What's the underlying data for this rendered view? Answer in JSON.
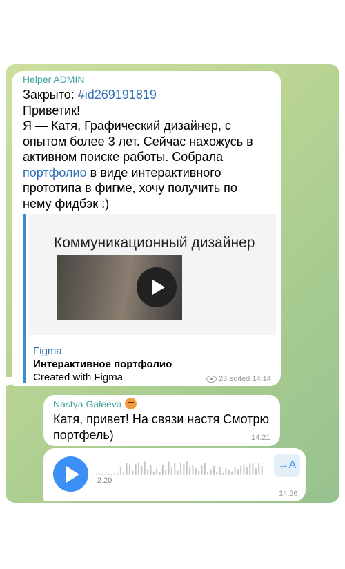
{
  "message1": {
    "sender": "Helper ADMIN",
    "closed_label": "Закрыто: ",
    "ticket_tag": "#id269191819",
    "greeting": "Приветик!",
    "line1": "Я — Катя, Графический дизайнер, с",
    "line2": "опытом более 3 лет. Сейчас нахожусь в",
    "line3": "активном поиске работы. Собрала",
    "portfolio_link": "портфолио",
    "line4_rest": " в виде интерактивного",
    "line5": "прототипа в фигме, хочу получить по",
    "line6": "нему фидбэк :)",
    "preview": {
      "image_title": "Коммуникационный дизайнер",
      "site": "Figma",
      "name": "Интерактивное портфолио",
      "description": "Created with Figma"
    },
    "views": "23",
    "edited_time": "edited 14:14"
  },
  "message2": {
    "sender": "Nastya Galeeva",
    "line1": "Катя, привет! На связи настя Смотрю",
    "line2": "портфель)",
    "time": "14:21"
  },
  "message3": {
    "duration": "2:20",
    "transcribe_label": "→A",
    "time": "14:26",
    "waveform": [
      0.1,
      0.1,
      0.1,
      0.1,
      0.1,
      0.1,
      0.15,
      0.12,
      0.55,
      0.25,
      0.8,
      0.7,
      0.3,
      0.75,
      0.85,
      0.6,
      0.9,
      0.4,
      0.65,
      0.25,
      0.45,
      0.2,
      0.7,
      0.35,
      0.9,
      0.5,
      0.8,
      0.3,
      0.85,
      0.75,
      0.95,
      0.55,
      0.7,
      0.45,
      0.3,
      0.65,
      0.8,
      0.2,
      0.4,
      0.6,
      0.25,
      0.5,
      0.15,
      0.45,
      0.35,
      0.25,
      0.55,
      0.4,
      0.6,
      0.7,
      0.5,
      0.75,
      0.8,
      0.45,
      0.8,
      0.6
    ],
    "played_fraction": 0.0
  },
  "colors": {
    "accent": "#3b8ff5",
    "link": "#2f6eb5",
    "sender_admin": "#3fa39b"
  }
}
